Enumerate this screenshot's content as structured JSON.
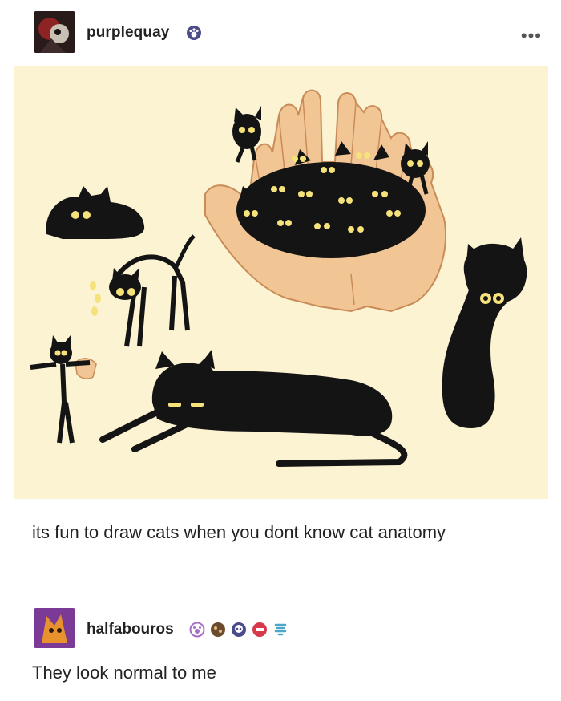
{
  "post": {
    "username": "purplequay",
    "more_label": "•••",
    "caption": "its fun to draw cats when you dont know cat anatomy"
  },
  "reply": {
    "username": "halfabouros",
    "text": "They look normal to me"
  },
  "colors": {
    "art_background": "#fbf3d2",
    "cat_black": "#121212",
    "hand_skin": "#f2c595",
    "eye_yellow": "#f6e27a"
  }
}
